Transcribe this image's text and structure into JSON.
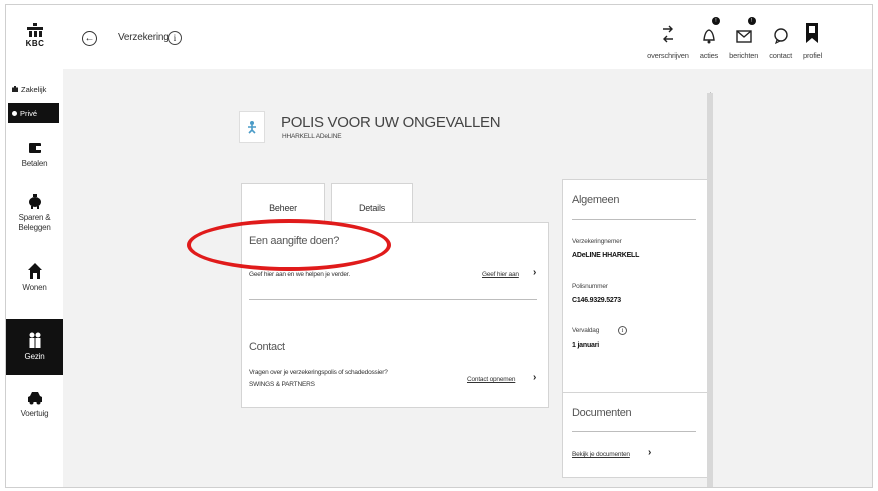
{
  "header": {
    "logo_text": "KBC",
    "breadcrumb": "Verzekering",
    "nav": [
      {
        "label": "overschrijven",
        "icon": "transfer-icon"
      },
      {
        "label": "acties",
        "icon": "bell-icon"
      },
      {
        "label": "berichten",
        "icon": "mail-icon"
      },
      {
        "label": "contact",
        "icon": "chat-icon"
      },
      {
        "label": "profiel",
        "icon": "profile-icon"
      }
    ]
  },
  "sidebar": {
    "segments": {
      "zakelijk": "Zakelijk",
      "prive": "Privé"
    },
    "items": [
      {
        "label": "Betalen",
        "icon": "wallet-icon"
      },
      {
        "label": "Sparen & Beleggen",
        "icon": "piggybank-icon"
      },
      {
        "label": "Wonen",
        "icon": "house-icon"
      },
      {
        "label": "Gezin",
        "icon": "family-icon",
        "active": true
      },
      {
        "label": "Voertuig",
        "icon": "car-icon"
      }
    ]
  },
  "policy": {
    "title": "POLIS VOOR UW ONGEVALLEN",
    "holder": "HHARKELL ADeLINE"
  },
  "tabs": {
    "beheer": "Beheer",
    "details": "Details"
  },
  "aangifte": {
    "title": "Een aangifte doen?",
    "text": "Geef hier aan en we helpen je verder.",
    "link": "Geef hier aan"
  },
  "contact": {
    "title": "Contact",
    "question": "Vragen over je verzekeringspolis of schadedossier?",
    "company": "SWINGS & PARTNERS",
    "link": "Contact opnemen"
  },
  "algemeen": {
    "title": "Algemeen",
    "rows": [
      {
        "key": "Verzekeringnemer",
        "value": "ADeLINE HHARKELL"
      },
      {
        "key": "Polisnummer",
        "value": "C146.9329.5273"
      },
      {
        "key": "Vervaldag",
        "value": "1 januari"
      }
    ]
  },
  "documenten": {
    "title": "Documenten",
    "link": "Bekijk je documenten"
  },
  "colors": {
    "accent": "#111111",
    "highlight": "#e01b1b",
    "background": "#f2f2f2"
  }
}
